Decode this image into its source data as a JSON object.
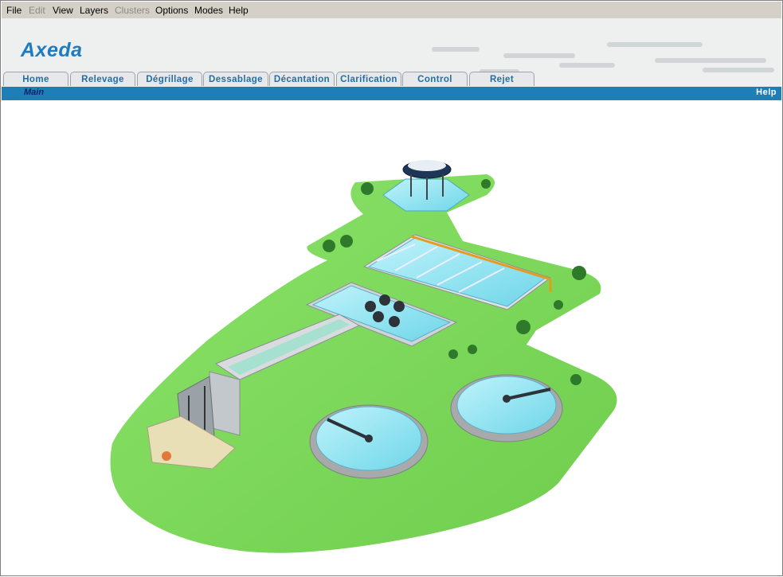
{
  "menu": {
    "file": "File",
    "edit": "Edit",
    "view": "View",
    "layers": "Layers",
    "clusters": "Clusters",
    "options": "Options",
    "modes": "Modes",
    "help": "Help"
  },
  "brand": {
    "logo": "Axeda"
  },
  "tabs": [
    "Home",
    "Relevage",
    "Dégrillage",
    "Dessablage",
    "Décantation",
    "Clarification",
    "Control",
    "Rejet"
  ],
  "subbar": {
    "left": "Main",
    "right": "Help"
  },
  "colors": {
    "accent_bar": "#1e7fb8",
    "tab_text": "#1f6fa9",
    "logo": "#1e7bbf",
    "grass": "#7fd65a",
    "water": "#8fe3f0"
  }
}
